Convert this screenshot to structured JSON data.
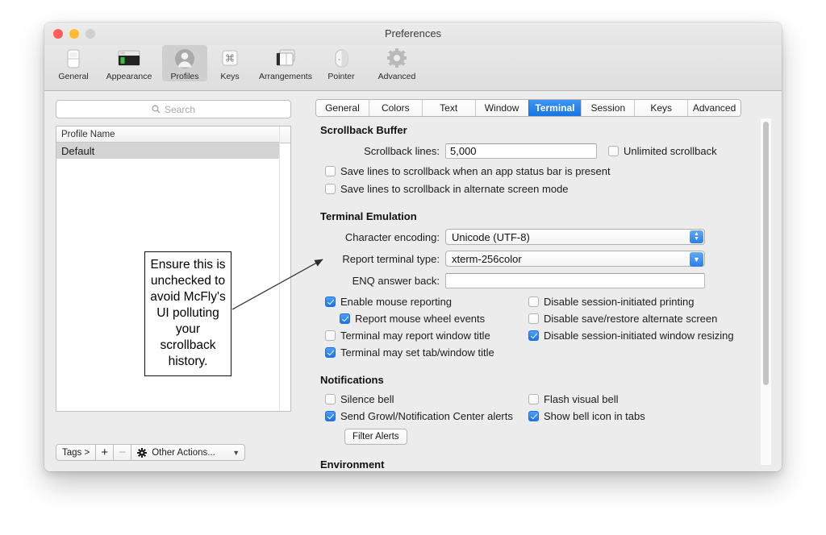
{
  "window": {
    "title": "Preferences",
    "traffic": {
      "close": "close-button",
      "minimize": "minimize-button",
      "zoom": "zoom-button"
    }
  },
  "toolbar": {
    "items": [
      {
        "label": "General",
        "icon": "general-icon"
      },
      {
        "label": "Appearance",
        "icon": "appearance-icon"
      },
      {
        "label": "Profiles",
        "icon": "profiles-icon"
      },
      {
        "label": "Keys",
        "icon": "keys-icon"
      },
      {
        "label": "Arrangements",
        "icon": "arrangements-icon"
      },
      {
        "label": "Pointer",
        "icon": "pointer-icon"
      },
      {
        "label": "Advanced",
        "icon": "advanced-icon"
      }
    ],
    "selected": "Profiles"
  },
  "sidebar": {
    "search": {
      "placeholder": "Search",
      "value": "",
      "icon": "search-icon"
    },
    "table": {
      "column_header": "Profile Name",
      "rows": [
        {
          "name": "Default",
          "selected": true
        }
      ]
    },
    "actions": {
      "tags_label": "Tags >",
      "add_label": "+",
      "remove_label": "−",
      "other_label": "Other Actions...",
      "other_icon": "gear-icon",
      "caret_icon": "chevron-down-icon"
    }
  },
  "annotation": {
    "text": "Ensure this is unchecked to avoid McFly's UI polluting your scrollback history.",
    "arrow": "annotation-arrow"
  },
  "tabs": {
    "items": [
      "General",
      "Colors",
      "Text",
      "Window",
      "Terminal",
      "Session",
      "Keys",
      "Advanced"
    ],
    "active": "Terminal"
  },
  "settings": {
    "scrollback": {
      "heading": "Scrollback Buffer",
      "lines_label": "Scrollback lines:",
      "lines_value": "5,000",
      "unlimited_label": "Unlimited scrollback",
      "unlimited_checked": false,
      "save_status_bar_label": "Save lines to scrollback when an app status bar is present",
      "save_status_bar_checked": false,
      "save_alternate_label": "Save lines to scrollback in alternate screen mode",
      "save_alternate_checked": false
    },
    "emulation": {
      "heading": "Terminal Emulation",
      "encoding_label": "Character encoding:",
      "encoding_value": "Unicode (UTF-8)",
      "termtype_label": "Report terminal type:",
      "termtype_value": "xterm-256color",
      "enq_label": "ENQ answer back:",
      "enq_value": "",
      "left_checks": [
        {
          "label": "Enable mouse reporting",
          "checked": true,
          "indent": false
        },
        {
          "label": "Report mouse wheel events",
          "checked": true,
          "indent": true
        },
        {
          "label": "Terminal may report window title",
          "checked": false,
          "indent": false
        },
        {
          "label": "Terminal may set tab/window title",
          "checked": true,
          "indent": false
        }
      ],
      "right_checks": [
        {
          "label": "Disable session-initiated printing",
          "checked": false
        },
        {
          "label": "Disable save/restore alternate screen",
          "checked": false
        },
        {
          "label": "Disable session-initiated window resizing",
          "checked": true
        }
      ]
    },
    "notifications": {
      "heading": "Notifications",
      "left_checks": [
        {
          "label": "Silence bell",
          "checked": false
        },
        {
          "label": "Send Growl/Notification Center alerts",
          "checked": true
        }
      ],
      "right_checks": [
        {
          "label": "Flash visual bell",
          "checked": false
        },
        {
          "label": "Show bell icon in tabs",
          "checked": true
        }
      ],
      "filter_button": "Filter Alerts"
    },
    "environment": {
      "heading": "Environment"
    }
  },
  "colors": {
    "accent_blue": "#1a76e8",
    "tab_active_blue": "#3d93f5",
    "window_bg": "#ececec",
    "selected_row": "#d4d4d4"
  }
}
